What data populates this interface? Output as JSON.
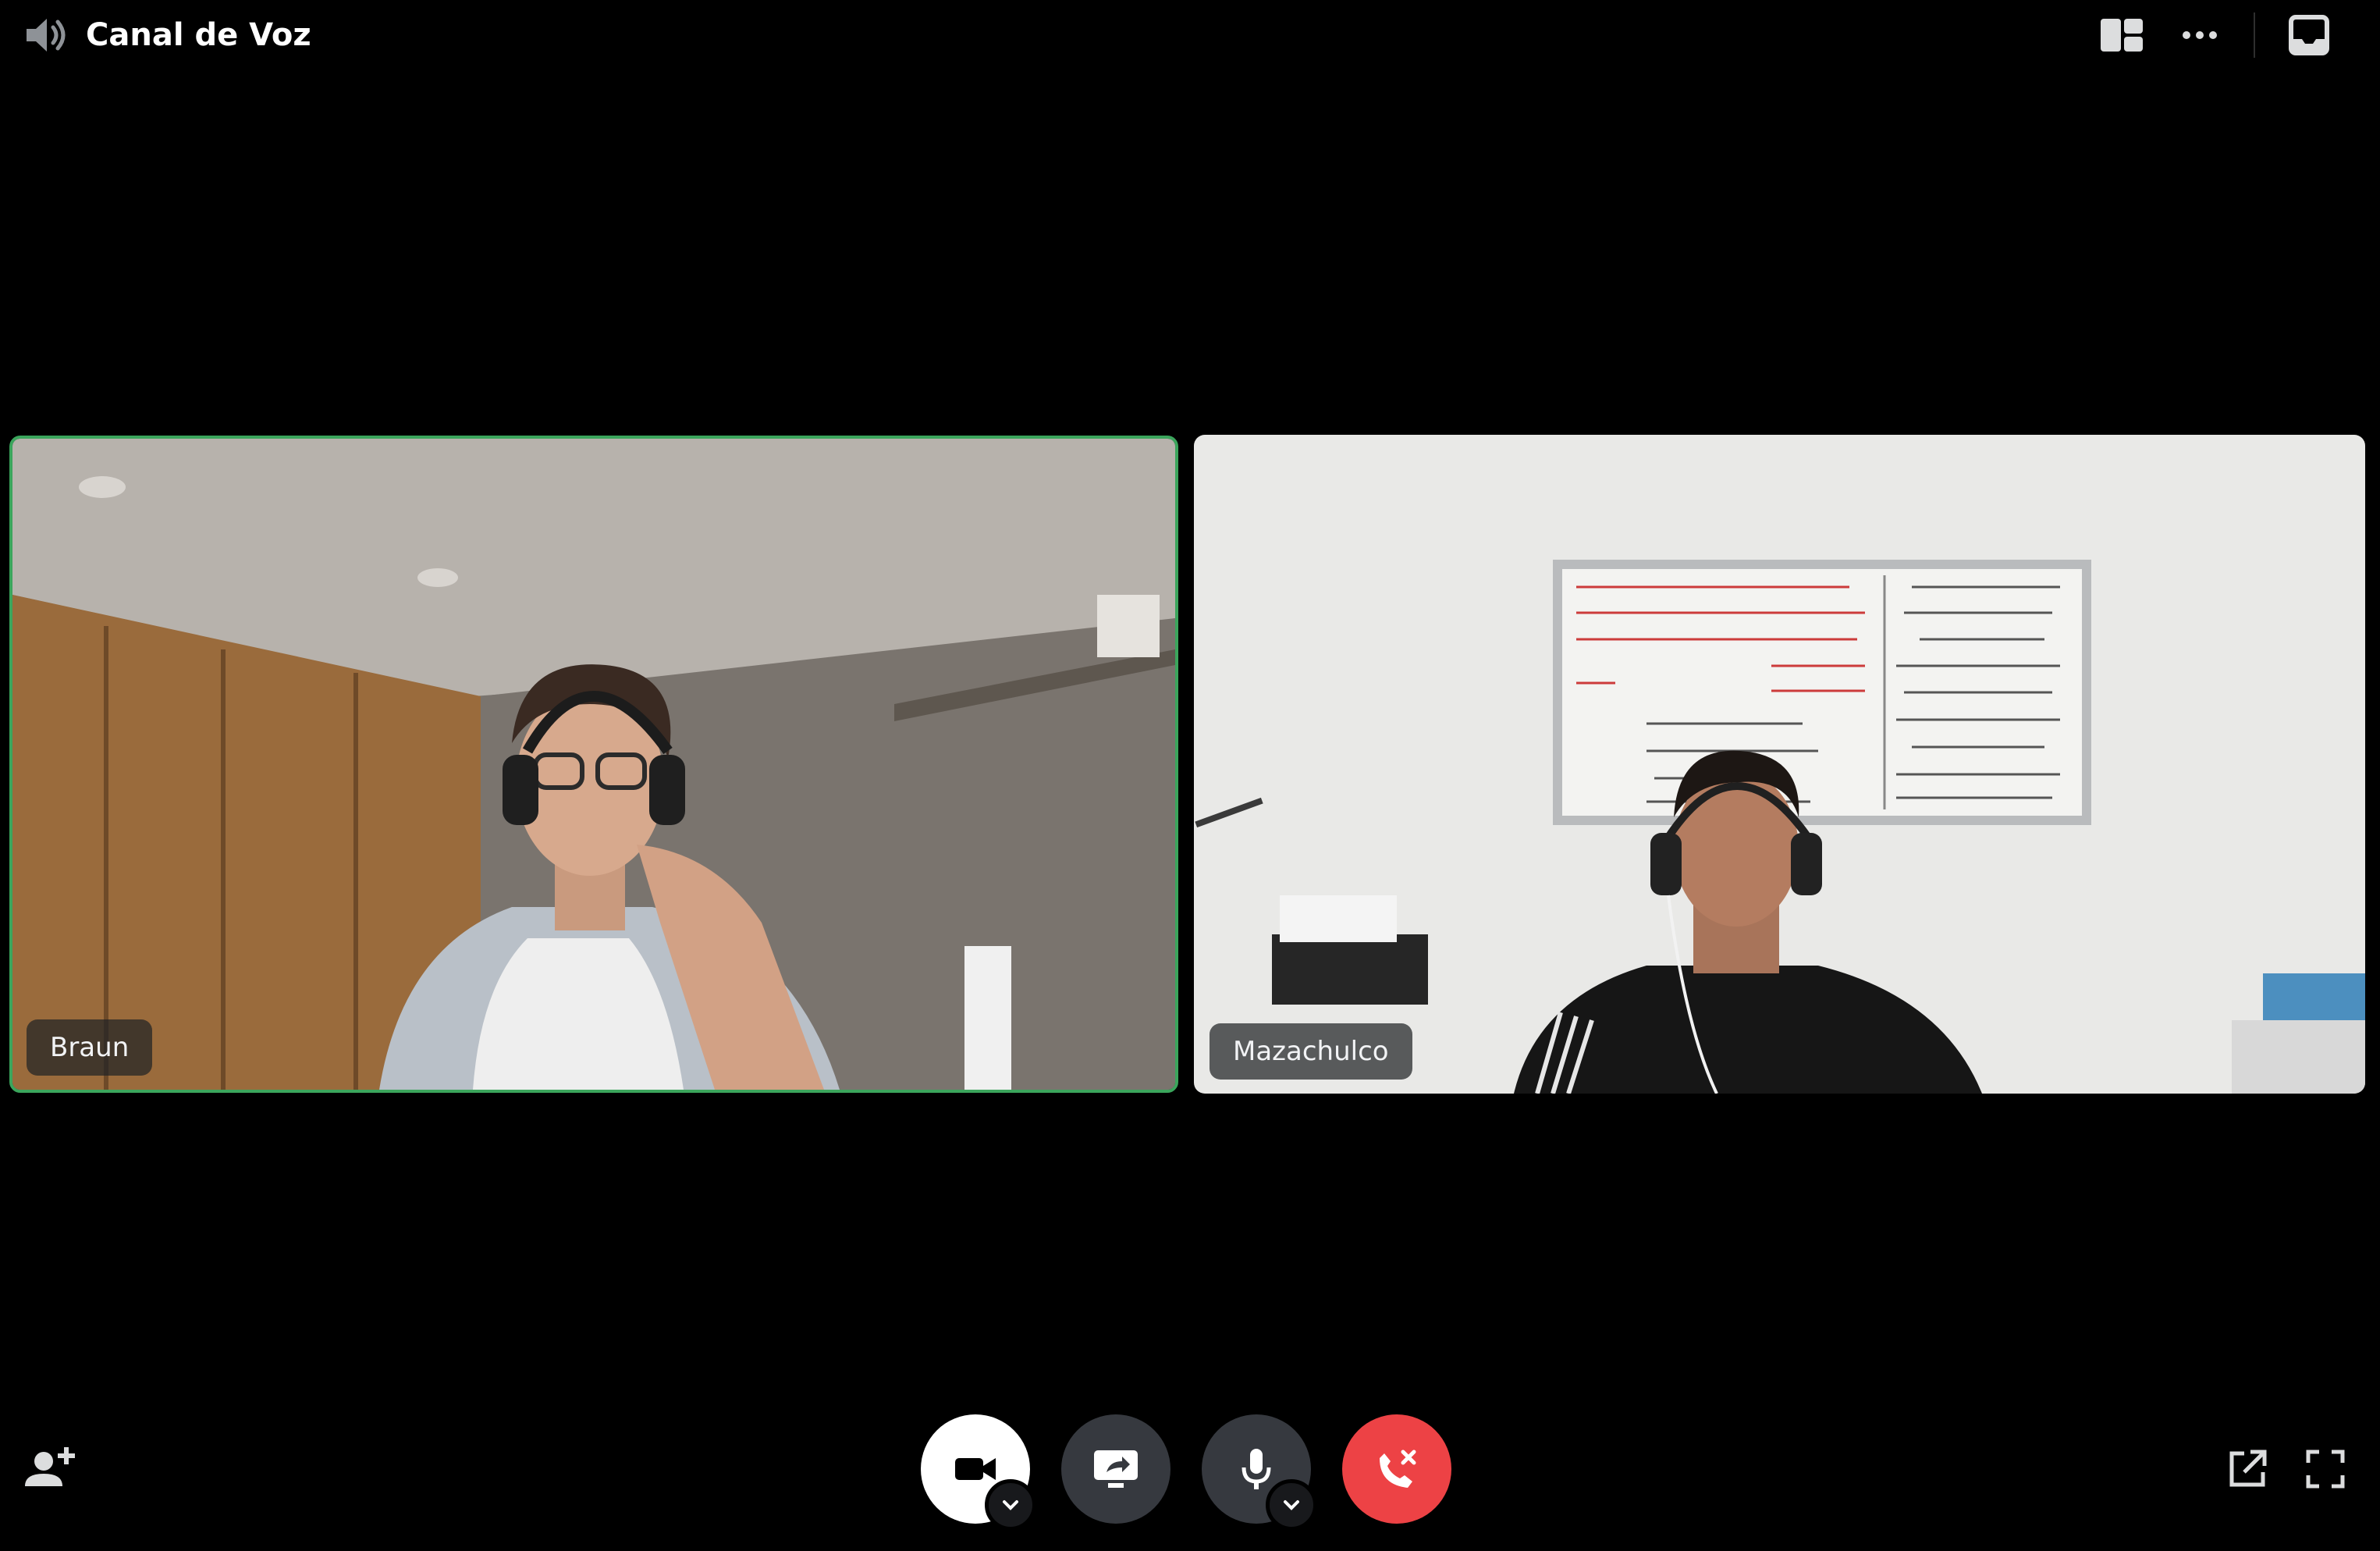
{
  "header": {
    "channel_icon": "speaker-icon",
    "channel_title": "Canal de Voz",
    "right_icons": [
      "grid-layout-icon",
      "more-icon",
      "inbox-icon"
    ]
  },
  "participants": [
    {
      "name": "Braun",
      "speaking": true,
      "border_color": "#3ba55c"
    },
    {
      "name": "Mazachulco",
      "speaking": false
    }
  ],
  "controls": {
    "camera_icon": "video-camera-icon",
    "share_icon": "screen-share-icon",
    "mic_icon": "microphone-icon",
    "leave_icon": "disconnect-call-icon",
    "caret_icon": "chevron-down-icon"
  },
  "footer": {
    "left_icon": "add-user-icon",
    "right_icons": [
      "popout-icon",
      "fullscreen-icon"
    ]
  },
  "colors": {
    "background": "#000000",
    "leave": "#ed4245",
    "speaking": "#3ba55c",
    "control_dark": "#36393f"
  }
}
